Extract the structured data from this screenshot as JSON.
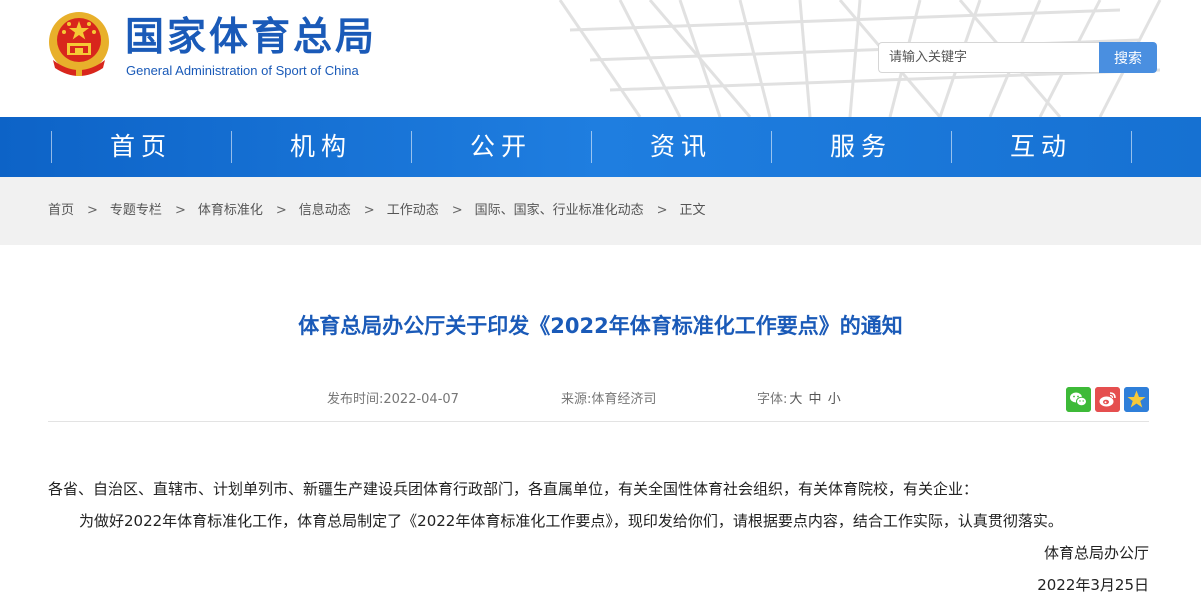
{
  "header": {
    "title_cn": "国家体育总局",
    "title_en": "General Administration of Sport of China",
    "search_placeholder": "请输入关键字",
    "search_button": "搜索"
  },
  "nav": {
    "items": [
      {
        "label": "首页"
      },
      {
        "label": "机构"
      },
      {
        "label": "公开"
      },
      {
        "label": "资讯"
      },
      {
        "label": "服务"
      },
      {
        "label": "互动"
      }
    ]
  },
  "breadcrumb": {
    "separator": ">",
    "items": [
      {
        "label": "首页"
      },
      {
        "label": "专题专栏"
      },
      {
        "label": "体育标准化"
      },
      {
        "label": "信息动态"
      },
      {
        "label": "工作动态"
      },
      {
        "label": "国际、国家、行业标准化动态"
      },
      {
        "label": "正文"
      }
    ]
  },
  "article": {
    "title": "体育总局办公厅关于印发《2022年体育标准化工作要点》的通知",
    "date_label": "发布时间:",
    "date": "2022-04-07",
    "source_label": "来源:",
    "source": "体育经济司",
    "font_label": "字体:",
    "font_large": "大",
    "font_medium": "中",
    "font_small": "小",
    "recipients": "各省、自治区、直辖市、计划单列市、新疆生产建设兵团体育行政部门，各直属单位，有关全国性体育社会组织，有关体育院校，有关企业：",
    "body": "为做好2022年体育标准化工作，体育总局制定了《2022年体育标准化工作要点》，现印发给你们，请根据要点内容，结合工作实际，认真贯彻落实。",
    "signer": "体育总局办公厅",
    "sign_date": "2022年3月25日"
  },
  "share": {
    "icons": [
      "wechat-icon",
      "weibo-icon",
      "favorite-star-icon"
    ]
  },
  "colors": {
    "brand_blue": "#1a5ab8",
    "nav_blue": "#1671d2",
    "search_button": "#4a8fe0",
    "breadcrumb_bg": "#f1f1f1"
  }
}
